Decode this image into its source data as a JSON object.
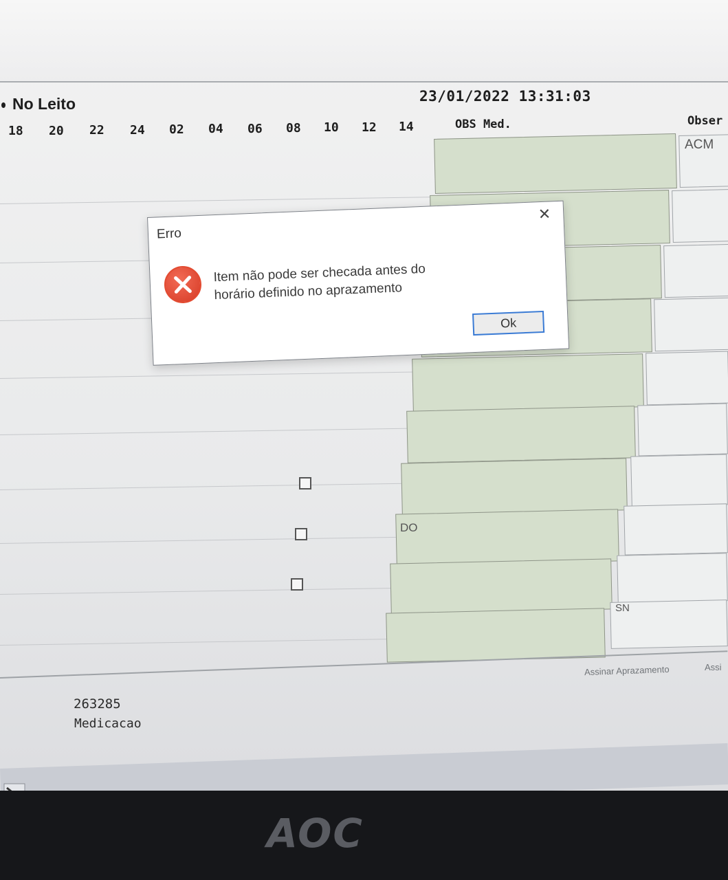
{
  "header": {
    "patient_label": "No Leito",
    "datetime": "23/01/2022 13:31:03",
    "hours": [
      "18",
      "20",
      "22",
      "24",
      "02",
      "04",
      "06",
      "08",
      "10",
      "12",
      "14"
    ],
    "obs_med_label": "OBS Med.",
    "obser_label": "Obser"
  },
  "grid": {
    "obs_values": [
      "ACM",
      "SN"
    ],
    "med_note": "DO"
  },
  "footer": {
    "sign_link": "Assinar Aprazamento",
    "sign_link_2": "Assi",
    "record_id": "263285",
    "record_type": "Medicacao"
  },
  "dialog": {
    "title": "Erro",
    "close_glyph": "✕",
    "icon": "error-icon",
    "message_line1": "Item não pode ser checada antes do",
    "message_line2": "horário definido no aprazamento",
    "ok_label": "Ok"
  },
  "monitor": {
    "brand": "AOC"
  },
  "colors": {
    "cell_green": "#d5dfcc",
    "error_red": "#e34b31",
    "focus_blue": "#3a7bd5"
  }
}
